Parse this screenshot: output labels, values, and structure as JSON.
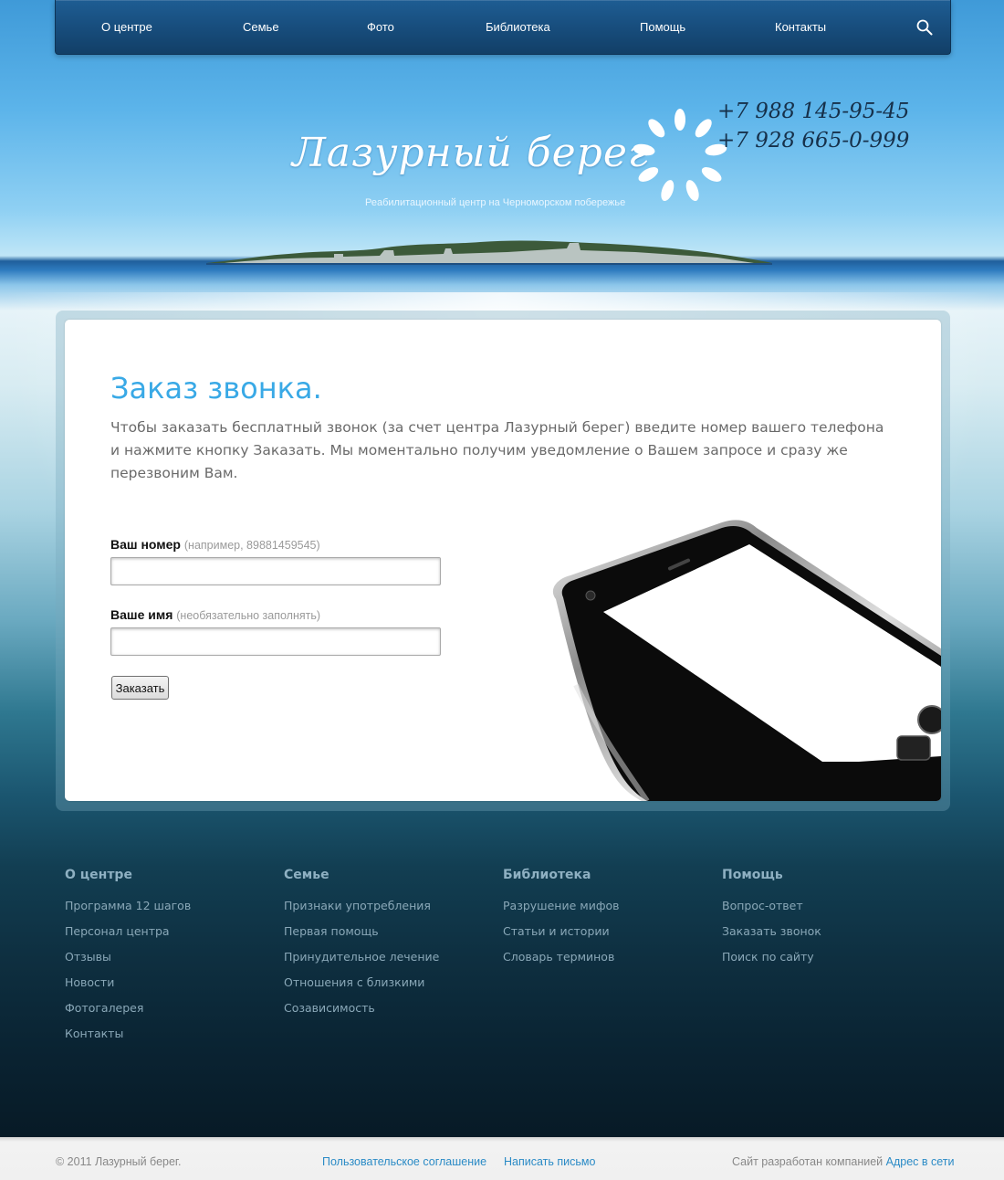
{
  "nav": {
    "items": [
      "О центре",
      "Семье",
      "Фото",
      "Библиотека",
      "Помощь",
      "Контакты"
    ],
    "search_icon": "search-icon"
  },
  "brand": {
    "name": "Лазурный берег",
    "tagline": "Реабилитационный центр на Черноморском побережье",
    "logo_icon": "sun-leaves-icon",
    "phones": [
      "+7 988 145-95-45",
      "+7 928 665-0-999"
    ]
  },
  "main": {
    "title": "Заказ звонка.",
    "intro": "Чтобы заказать бесплатный звонок (за счет центра Лазурный берег) введите номер вашего телефона и нажмите кнопку Заказать. Мы моментально получим уведомление о Вашем запросе и сразу же перезвоним Вам.",
    "form": {
      "phone_label": "Ваш номер",
      "phone_hint": "(например, 89881459545)",
      "phone_value": "",
      "name_label": "Ваше имя",
      "name_hint": "(необязательно заполнять)",
      "name_value": "",
      "submit_label": "Заказать"
    }
  },
  "footer": {
    "columns": [
      {
        "title": "О центре",
        "links": [
          "Программа 12 шагов",
          "Персонал центра",
          "Отзывы",
          "Новости",
          "Фотогалерея",
          "Контакты"
        ]
      },
      {
        "title": "Семье",
        "links": [
          "Признаки употребления",
          "Первая помощь",
          "Принудительное лечение",
          "Отношения с близкими",
          "Созависимость"
        ]
      },
      {
        "title": "Библиотека",
        "links": [
          "Разрушение мифов",
          "Статьи и истории",
          "Словарь терминов"
        ]
      },
      {
        "title": "Помощь",
        "links": [
          "Вопрос-ответ",
          "Заказать звонок",
          "Поиск по сайту"
        ]
      }
    ]
  },
  "bottom": {
    "copyright": "© 2011 Лазурный берег.",
    "links": [
      "Пользовательское соглашение",
      "Написать письмо"
    ],
    "credit_text": "Сайт разработан компанией",
    "credit_link": "Адрес в сети"
  },
  "colors": {
    "accent": "#39a9e6",
    "nav_bg": "#174c7b",
    "link": "#2b8bc6"
  }
}
